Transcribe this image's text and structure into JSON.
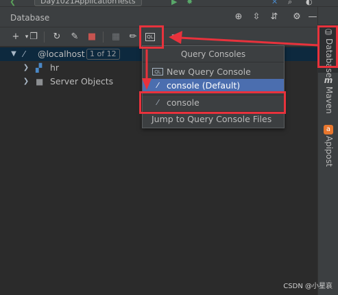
{
  "topbar": {
    "run_config": "Day1021ApplicationTests"
  },
  "panel": {
    "title": "Database"
  },
  "tree": {
    "root": {
      "label": "@localhost",
      "badge": "1 of 12"
    },
    "children": [
      {
        "label": "hr"
      },
      {
        "label": "Server Objects"
      }
    ]
  },
  "popup": {
    "header": "Query Consoles",
    "items": [
      {
        "label": "New Query Console",
        "icon": "ql-console-icon"
      },
      {
        "label": "console (Default)",
        "icon": "mysql-dolphin-icon",
        "active": true
      },
      {
        "label": "console",
        "icon": "mysql-dolphin-icon"
      },
      {
        "label": "Jump to Query Console Files"
      }
    ]
  },
  "right_bar": {
    "tabs": [
      {
        "label": "Database",
        "active": true
      },
      {
        "label": "Maven"
      },
      {
        "label": "Apipost"
      }
    ]
  },
  "watermark": "CSDN @小星哀",
  "colors": {
    "background": "#2b2b2b",
    "panel": "#3c3f41",
    "selection": "#0d293e",
    "popup_active": "#4b6eaf",
    "annotation_red": "#e8323c"
  }
}
